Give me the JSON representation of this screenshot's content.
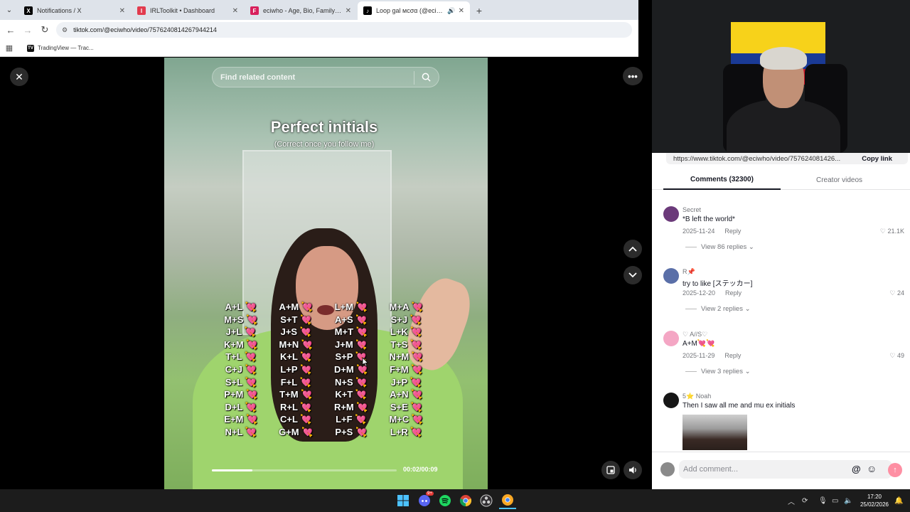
{
  "browser": {
    "tabs": [
      {
        "title": "Notifications / X",
        "favicon": "x-logo-icon",
        "color": "#000000",
        "glyph": "X"
      },
      {
        "title": "IRLToolkit • Dashboard",
        "favicon": "irltoolkit-icon",
        "color": "#e23b4e",
        "glyph": "I"
      },
      {
        "title": "eciwho - Age, Bio, Family | Fam",
        "favicon": "famous-icon",
        "color": "#d8205c",
        "glyph": "F"
      },
      {
        "title": "Loop gal мcσα (@eciwho) |",
        "favicon": "tiktok-icon",
        "color": "#000000",
        "glyph": "♪",
        "active": true,
        "audio": true
      }
    ],
    "url": "tiktok.com/@eciwho/video/7576240814267944214",
    "bookmark": {
      "label": "TradingView — Trac...",
      "icon": "tradingview-icon",
      "glyph": "TV"
    }
  },
  "video": {
    "search_placeholder": "Find related content",
    "title": "Perfect initials",
    "subtitle": "(Correct once you follow me)",
    "columns": [
      [
        "A+L",
        "M+S",
        "J+L",
        "K+M",
        "T+L",
        "C+J",
        "S+L",
        "P+M",
        "D+L",
        "E+M",
        "N+L"
      ],
      [
        "A+M",
        "S+T",
        "J+S",
        "M+N",
        "K+L",
        "L+P",
        "F+L",
        "T+M",
        "R+L",
        "C+L",
        "G+M"
      ],
      [
        "L+M",
        "A+S",
        "M+T",
        "J+M",
        "S+P",
        "D+M",
        "N+S",
        "K+T",
        "R+M",
        "L+F",
        "P+S"
      ],
      [
        "M+A",
        "S+J",
        "L+K",
        "T+S",
        "N+M",
        "F+M",
        "J+P",
        "A+N",
        "S+E",
        "M+C",
        "L+R"
      ]
    ],
    "heart": "💘",
    "time": "00:02/00:09",
    "progress": 0.22
  },
  "panel": {
    "share_link": "https://www.tiktok.com/@eciwho/video/757624081426...",
    "copy_label": "Copy link",
    "tabs": [
      "Comments (32300)",
      "Creator videos"
    ],
    "comments": [
      {
        "name": "Secret",
        "text": "*B left the world*",
        "date": "2025-11-24",
        "reply": "Reply",
        "likes": "21.1K",
        "view_replies": "View 86 replies",
        "avatar_color": "#6b3a7a"
      },
      {
        "name": "R📌",
        "text": "try to like [ステッカー]",
        "date": "2025-12-20",
        "reply": "Reply",
        "likes": "24",
        "view_replies": "View 2 replies",
        "avatar_color": "#5a6fa8"
      },
      {
        "name": "♡ A//S♡",
        "text": "A+M💘💘",
        "date": "2025-11-29",
        "reply": "Reply",
        "likes": "49",
        "view_replies": "View 3 replies",
        "avatar_color": "#f4a6c4"
      },
      {
        "name": "5⭐ Noah",
        "text": "Then I saw all me and mu ex initials",
        "avatar_color": "#161616"
      }
    ],
    "add_comment_placeholder": "Add comment..."
  },
  "taskbar": {
    "apps": [
      "windows-start-icon",
      "discord-icon",
      "spotify-icon",
      "chrome-icon",
      "obs-icon",
      "chrome-canary-icon"
    ],
    "discord_badge": "9+",
    "time": "17:20",
    "date": "25/02/2026"
  },
  "colors": {
    "accent": "#fe2c55",
    "send": "#fe8fa3",
    "taskbar": "#1c1c1c"
  }
}
